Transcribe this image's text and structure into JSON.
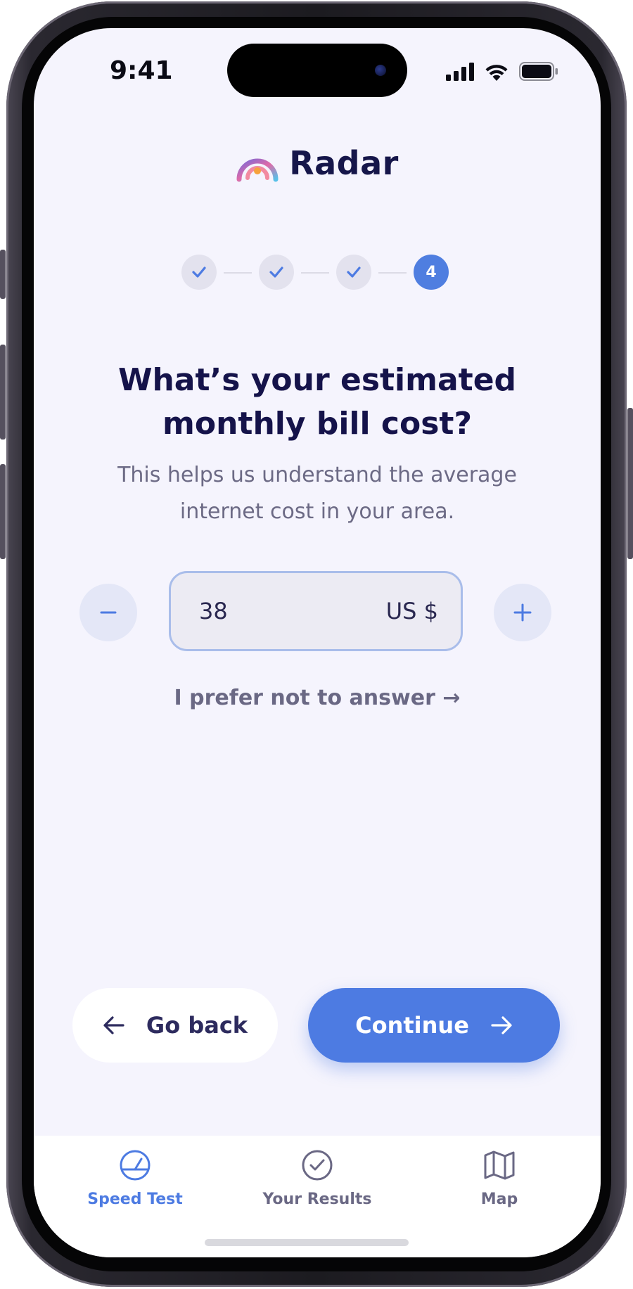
{
  "status_bar": {
    "time": "9:41"
  },
  "brand": {
    "name": "Radar"
  },
  "stepper": {
    "steps": [
      {
        "state": "done",
        "label": ""
      },
      {
        "state": "done",
        "label": ""
      },
      {
        "state": "done",
        "label": ""
      },
      {
        "state": "current",
        "label": "4"
      }
    ]
  },
  "question": {
    "title_line1": "What’s your estimated",
    "title_line2": "monthly bill cost?",
    "subtitle_line1": "This helps us understand the average",
    "subtitle_line2": "internet cost in your area."
  },
  "amount": {
    "value": "38",
    "currency": "US $"
  },
  "skip_label": "I prefer not to answer →",
  "actions": {
    "back_label": "Go back",
    "continue_label": "Continue"
  },
  "tabs": [
    {
      "label": "Speed Test",
      "icon": "speedometer-icon",
      "active": true
    },
    {
      "label": "Your Results",
      "icon": "check-circle-icon",
      "active": false
    },
    {
      "label": "Map",
      "icon": "map-icon",
      "active": false
    }
  ],
  "colors": {
    "accent": "#4d7be2",
    "heading": "#15134a",
    "muted": "#6c6a85",
    "screen_bg": "#f5f4fd"
  }
}
